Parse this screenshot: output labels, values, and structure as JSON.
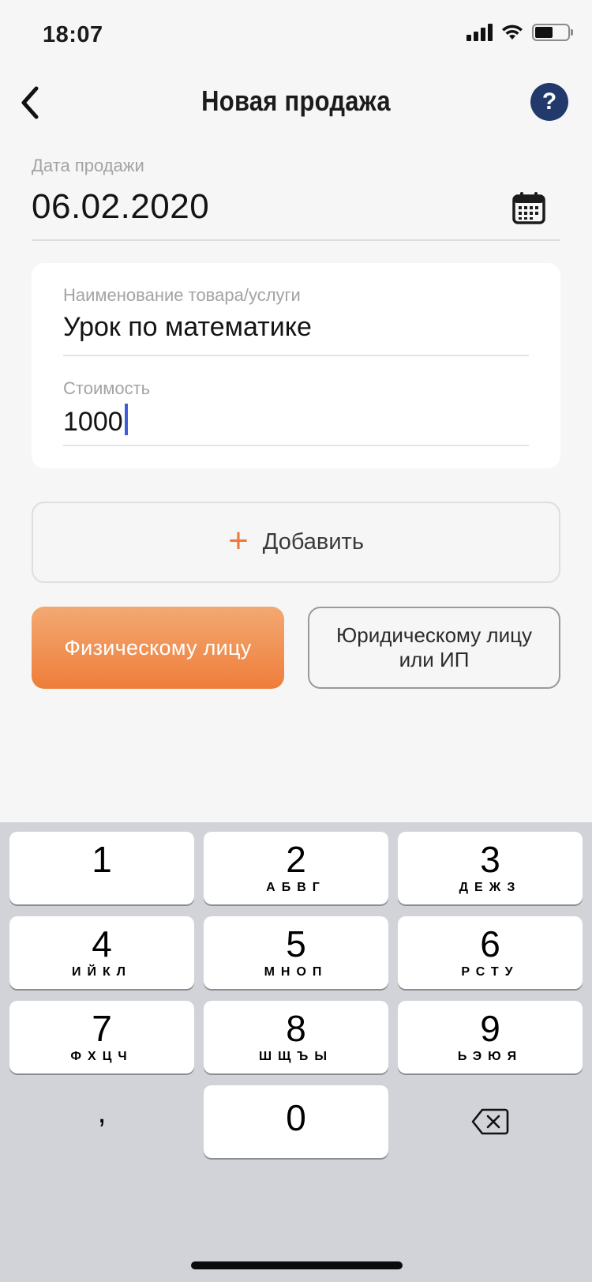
{
  "status_bar": {
    "time": "18:07",
    "battery_level": 0.55
  },
  "header": {
    "title": "Новая продажа",
    "back_icon": "chevron-left-icon",
    "help_label": "?"
  },
  "sale_date": {
    "label": "Дата продажи",
    "value": "06.02.2020",
    "icon": "calendar-icon"
  },
  "item": {
    "name_label": "Наименование товара/услуги",
    "name_value": "Урок по математике",
    "price_label": "Стоимость",
    "price_value": "1000"
  },
  "add_button": {
    "icon": "+",
    "label": "Добавить"
  },
  "buyer_buttons": {
    "individual": "Физическому лицу",
    "legal_line1": "Юридическому лицу",
    "legal_line2": "или ИП"
  },
  "colors": {
    "accent": "#ef7d3a",
    "help_bg": "#213a6b",
    "cursor": "#3e5bd9"
  },
  "keyboard": {
    "keys": [
      {
        "digit": "1",
        "letters": ""
      },
      {
        "digit": "2",
        "letters": "АБВГ"
      },
      {
        "digit": "3",
        "letters": "ДЕЖЗ"
      },
      {
        "digit": "4",
        "letters": "ИЙКЛ"
      },
      {
        "digit": "5",
        "letters": "МНОП"
      },
      {
        "digit": "6",
        "letters": "РСТУ"
      },
      {
        "digit": "7",
        "letters": "ФХЦЧ"
      },
      {
        "digit": "8",
        "letters": "ШЩЪЫ"
      },
      {
        "digit": "9",
        "letters": "ЬЭЮЯ"
      },
      {
        "digit": ",",
        "letters": ""
      },
      {
        "digit": "0",
        "letters": ""
      },
      {
        "digit": "",
        "letters": ""
      }
    ],
    "delete_icon": "backspace-icon"
  }
}
